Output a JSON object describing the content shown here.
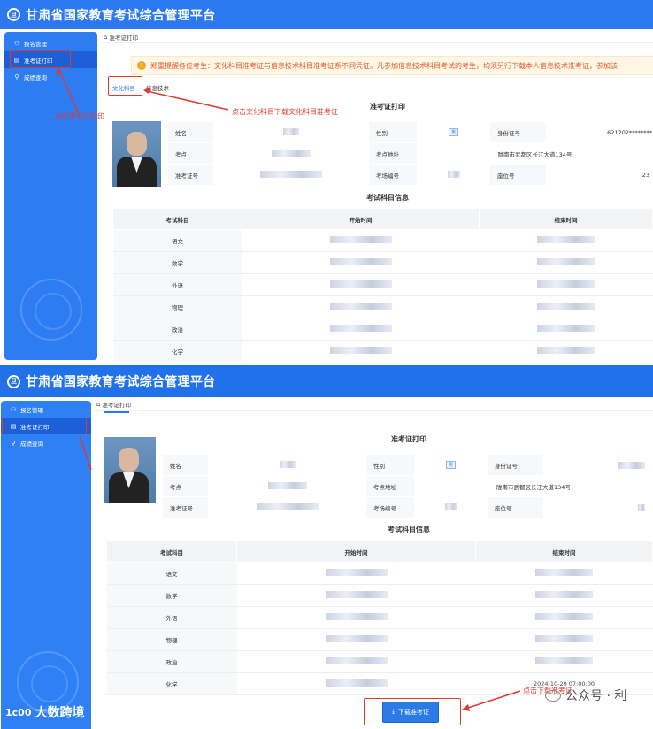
{
  "app": {
    "title": "甘肃省国家教育考试综合管理平台",
    "logo_text": "旦"
  },
  "sidebar": {
    "items": [
      {
        "label": "报名管理",
        "icon": "user-icon"
      },
      {
        "label": "准考证打印",
        "icon": "document-icon"
      },
      {
        "label": "成绩查询",
        "icon": "search-icon"
      }
    ]
  },
  "breadcrumb": "准考证打印",
  "notice": "郑重提醒各位考生：文化科目准考证与信息技术科目准考证系不同凭证。凡参加信息技术科目考试的考生，均须另行下载本人信息技术准考证，参加该",
  "tabs": [
    "文化科目",
    "信息技术"
  ],
  "admission_title": "准考证打印",
  "exam_info_title": "考试科目信息",
  "fields": {
    "name_label": "姓名",
    "gender_label": "性别",
    "gender_value": "男",
    "id_label": "身份证号",
    "id_value": "621202********",
    "site_label": "考点",
    "address_label": "考点地址",
    "address_value": "陇南市武都区长江大道134号",
    "ticket_label": "准考证号",
    "room_label": "考场编号",
    "seat_label": "座位号",
    "seat_value": "23"
  },
  "exam_table": {
    "headers": [
      "考试科目",
      "开始时间",
      "结束时间"
    ],
    "subjects": [
      "语文",
      "数学",
      "外语",
      "物理",
      "政治",
      "化学"
    ],
    "visible_end_time": "2024-10-29 07:00:00"
  },
  "annotations": {
    "click_ticket_print": "点击准考证打印",
    "click_culture_tab": "点击文化科目下载文化科目准考证",
    "click_download": "点击下载准考证"
  },
  "download_button": "下载准考证",
  "branding": {
    "footer": "大数跨境",
    "footer_mark": "1c00",
    "watermark": "公众号 · 利"
  }
}
